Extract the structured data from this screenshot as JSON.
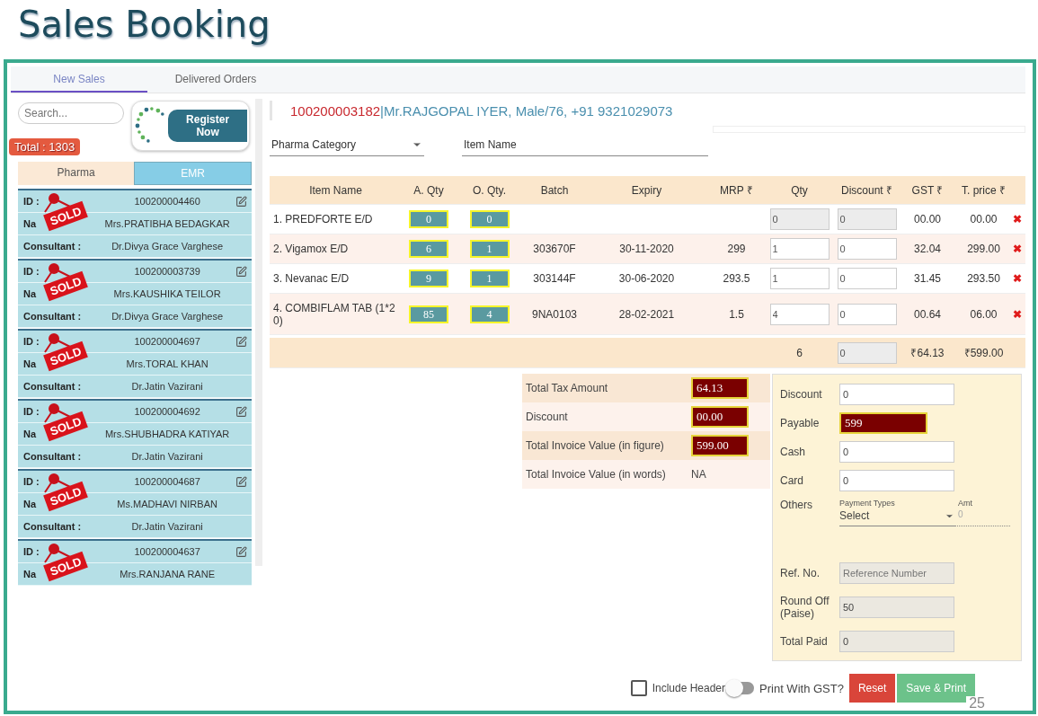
{
  "slide": {
    "title": "Sales Booking",
    "page_number": "25"
  },
  "tabs": [
    {
      "label": "New Sales",
      "selected": true
    },
    {
      "label": "Delivered Orders",
      "selected": false
    }
  ],
  "sidebar": {
    "search": {
      "placeholder": "Search..."
    },
    "register_button": "Register Now",
    "total": "Total : 1303",
    "toggle": [
      {
        "label": "Pharma",
        "selected": false
      },
      {
        "label": "EMR",
        "selected": true
      }
    ],
    "cards": [
      {
        "id_label": "ID :",
        "id": "100200004460",
        "name_label": "Na",
        "name": "Mrs.PRATIBHA BEDAGKAR",
        "consultant_label": "Consultant :",
        "consultant": "Dr.Divya Grace Varghese",
        "sold": "SOLD"
      },
      {
        "id_label": "ID :",
        "id": "100200003739",
        "name_label": "Na",
        "name": "Mrs.KAUSHIKA TEILOR",
        "consultant_label": "Consultant :",
        "consultant": "Dr.Divya Grace Varghese",
        "sold": "SOLD"
      },
      {
        "id_label": "ID :",
        "id": "100200004697",
        "name_label": "Na",
        "name": "Mrs.TORAL KHAN",
        "consultant_label": "Consultant :",
        "consultant": "Dr.Jatin Vazirani",
        "sold": "SOLD"
      },
      {
        "id_label": "ID :",
        "id": "100200004692",
        "name_label": "Na",
        "name": "Mrs.SHUBHADRA KATIYAR",
        "consultant_label": "Consultant :",
        "consultant": "Dr.Jatin Vazirani",
        "sold": "SOLD"
      },
      {
        "id_label": "ID :",
        "id": "100200004687",
        "name_label": "Na",
        "name": "Ms.MADHAVI NIRBAN",
        "consultant_label": "Consultant :",
        "consultant": "Dr.Jatin Vazirani",
        "sold": "SOLD"
      },
      {
        "id_label": "ID :",
        "id": "100200004637",
        "name_label": "Na",
        "name": "Mrs.RANJANA RANE",
        "sold": "SOLD"
      }
    ]
  },
  "patient": {
    "id": "100200003182",
    "details": "|Mr.RAJGOPAL IYER, Male/76, +91 9321029073"
  },
  "filters": {
    "category": "Pharma Category",
    "item_name": "Item Name"
  },
  "table": {
    "columns": [
      "Item Name",
      "A. Qty",
      "O. Qty.",
      "Batch",
      "Expiry",
      "MRP ₹",
      "Qty",
      "Discount ₹",
      "GST ₹",
      "T. price ₹"
    ],
    "rows": [
      {
        "item": "1. PREDFORTE E/D",
        "a_qty": "0",
        "o_qty": "0",
        "batch": "",
        "expiry": "",
        "mrp": "",
        "qty": "0",
        "discount": "0",
        "gst": "00.00",
        "price": "00.00",
        "disabled": true,
        "remove": "✖"
      },
      {
        "item": "2. Vigamox E/D",
        "a_qty": "6",
        "o_qty": "1",
        "batch": "303670F",
        "expiry": "30-11-2020",
        "mrp": "299",
        "qty": "1",
        "discount": "0",
        "gst": "32.04",
        "price": "299.00",
        "disabled": false,
        "remove": "✖"
      },
      {
        "item": "3. Nevanac E/D",
        "a_qty": "9",
        "o_qty": "1",
        "batch": "303144F",
        "expiry": "30-06-2020",
        "mrp": "293.5",
        "qty": "1",
        "discount": "0",
        "gst": "31.45",
        "price": "293.50",
        "disabled": false,
        "remove": "✖"
      },
      {
        "item": "4. COMBIFLAM TAB (1*2 0)",
        "a_qty": "85",
        "o_qty": "4",
        "batch": "9NA0103",
        "expiry": "28-02-2021",
        "mrp": "1.5",
        "qty": "4",
        "discount": "0",
        "gst": "00.64",
        "price": "06.00",
        "disabled": false,
        "remove": "✖"
      }
    ],
    "total": {
      "qty": "6",
      "discount": "0",
      "gst": "₹64.13",
      "price": "₹599.00"
    }
  },
  "summary": [
    {
      "label": "Total Tax Amount",
      "value": "64.13",
      "kind": "highlight"
    },
    {
      "label": "Discount",
      "value": "00.00",
      "kind": "highlight"
    },
    {
      "label": "Total Invoice Value (in figure)",
      "value": "599.00",
      "kind": "highlight"
    },
    {
      "label": "Total Invoice Value (in words)",
      "value": "NA",
      "kind": "text"
    }
  ],
  "payment": [
    {
      "label": "Discount",
      "value": "0",
      "kind": "input"
    },
    {
      "label": "Payable",
      "value": "599",
      "kind": "highlight"
    },
    {
      "label": "Cash",
      "value": "0",
      "kind": "input"
    },
    {
      "label": "Card",
      "value": "0",
      "kind": "input"
    },
    {
      "label": "Others",
      "kind": "select",
      "type_label": "Payment Types",
      "value": "Select",
      "amt_label": "Amt",
      "amt": "0"
    },
    {
      "label": "Ref. No.",
      "placeholder": "Reference Number",
      "kind": "disabled"
    },
    {
      "label": "Round Off (Paise)",
      "value": "50",
      "kind": "disabled"
    },
    {
      "label": "Total Paid",
      "value": "0",
      "kind": "disabled"
    }
  ],
  "footer": {
    "include_header": {
      "label": "Include Header",
      "checked": false
    },
    "print_gst": {
      "label": "Print With GST?",
      "on": false
    },
    "buttons": [
      {
        "label": "Reset",
        "kind": "danger"
      },
      {
        "label": "Save & Print",
        "kind": "success"
      }
    ]
  }
}
